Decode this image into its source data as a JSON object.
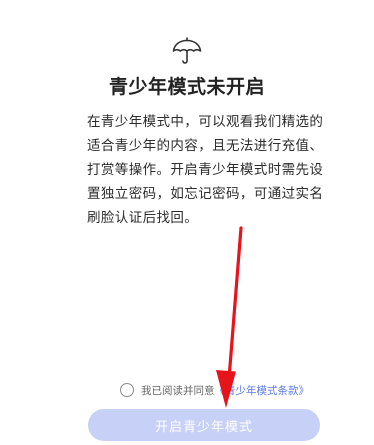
{
  "teen_mode": {
    "icon": "umbrella-icon",
    "title": "青少年模式未开启",
    "description_lines": [
      "在青少年模式中，可以观看我们精选的",
      "适合青少年的内容，且无法进行充值、",
      "打赏等操作。开启青少年模式时需先设",
      "置独立密码，如忘记密码，可通过实名",
      "刷脸认证后找回。"
    ],
    "agreement_prefix": "我已阅读并同意",
    "agreement_link": "《青少年模式条款》",
    "agreement_checked": false,
    "enable_button_label": "开启青少年模式"
  },
  "annotation": {
    "arrow_color": "#e8141b"
  },
  "colors": {
    "link": "#5b7be8",
    "button_disabled_bg": "#c7d0f6"
  }
}
